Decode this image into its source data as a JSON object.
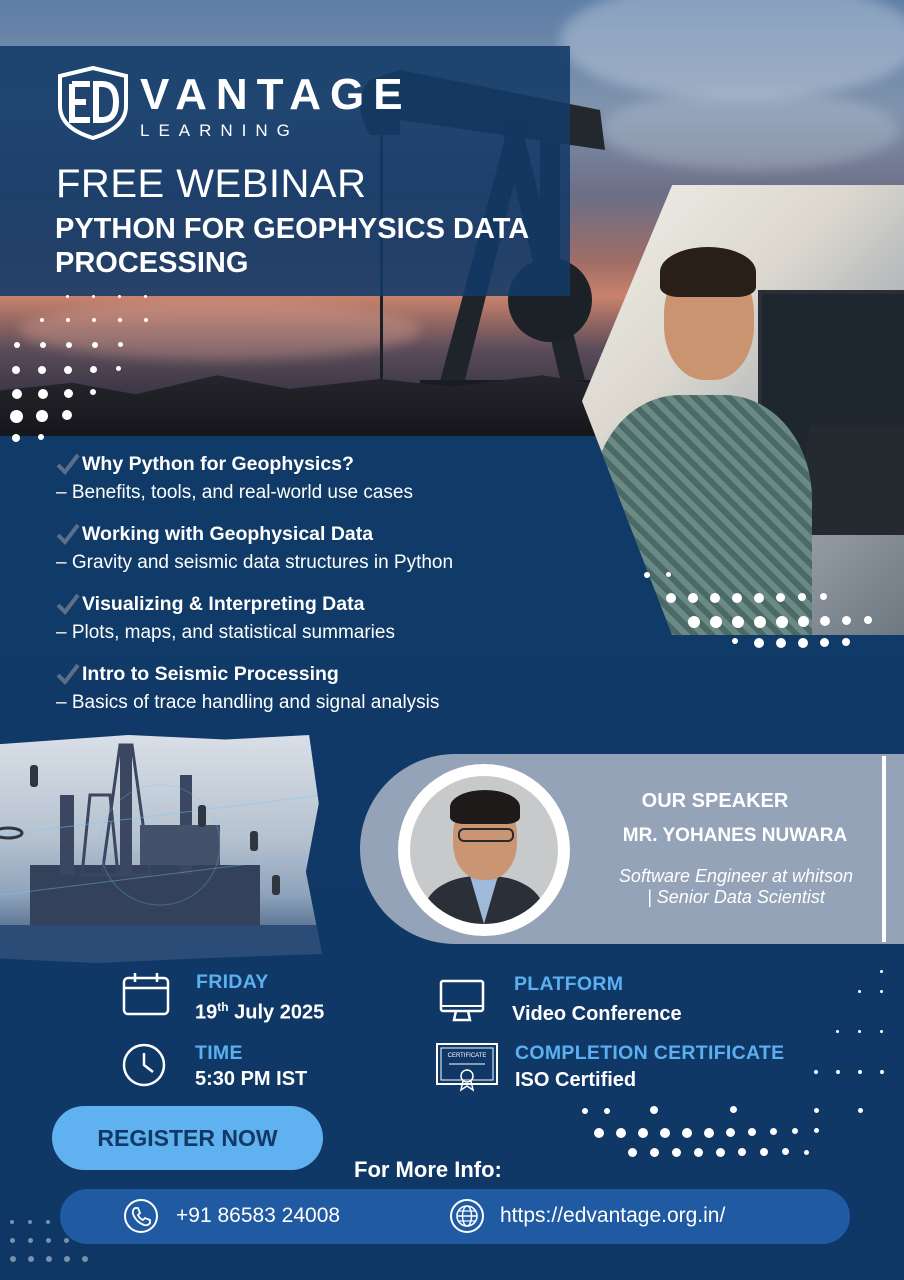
{
  "brand": {
    "logo_word": "VANTAGE",
    "logo_sub": "LEARNING"
  },
  "hero": {
    "kicker": "FREE WEBINAR",
    "title": "PYTHON FOR GEOPHYSICS DATA PROCESSING"
  },
  "agenda": [
    {
      "title": "Why Python for Geophysics?",
      "detail": "– Benefits, tools, and real-world use cases"
    },
    {
      "title": "Working with Geophysical Data",
      "detail": "– Gravity and seismic data structures in Python"
    },
    {
      "title": "Visualizing & Interpreting Data",
      "detail": "– Plots, maps, and statistical summaries"
    },
    {
      "title": "Intro to Seismic Processing",
      "detail": "– Basics of trace handling and signal analysis"
    }
  ],
  "speaker": {
    "label": "OUR SPEAKER",
    "name": "MR. YOHANES NUWARA",
    "role": "Software Engineer at whitson | Senior Data Scientist"
  },
  "details": {
    "day_label": "FRIDAY",
    "date_day": "19",
    "date_suffix": "th",
    "date_rest": " July 2025",
    "time_label": "TIME",
    "time_value": "5:30 PM IST",
    "platform_label": "PLATFORM",
    "platform_value": "Video Conference",
    "cert_label": "COMPLETION CERTIFICATE",
    "cert_value": "ISO Certified",
    "cert_badge_text": "CERTIFICATE"
  },
  "cta": {
    "register": "REGISTER NOW",
    "more_info": "For More Info:",
    "phone": "+91 86583 24008",
    "website": "https://edvantage.org.in/"
  },
  "colors": {
    "background": "#0f3766",
    "accent": "#5bb0f0",
    "button": "#5fb2ef",
    "contact_bar": "#1f5aa3",
    "speaker_card": "#94a3b8"
  },
  "icons": [
    "calendar-icon",
    "clock-icon",
    "monitor-icon",
    "certificate-icon",
    "phone-icon",
    "globe-icon",
    "checkmark-icon"
  ]
}
